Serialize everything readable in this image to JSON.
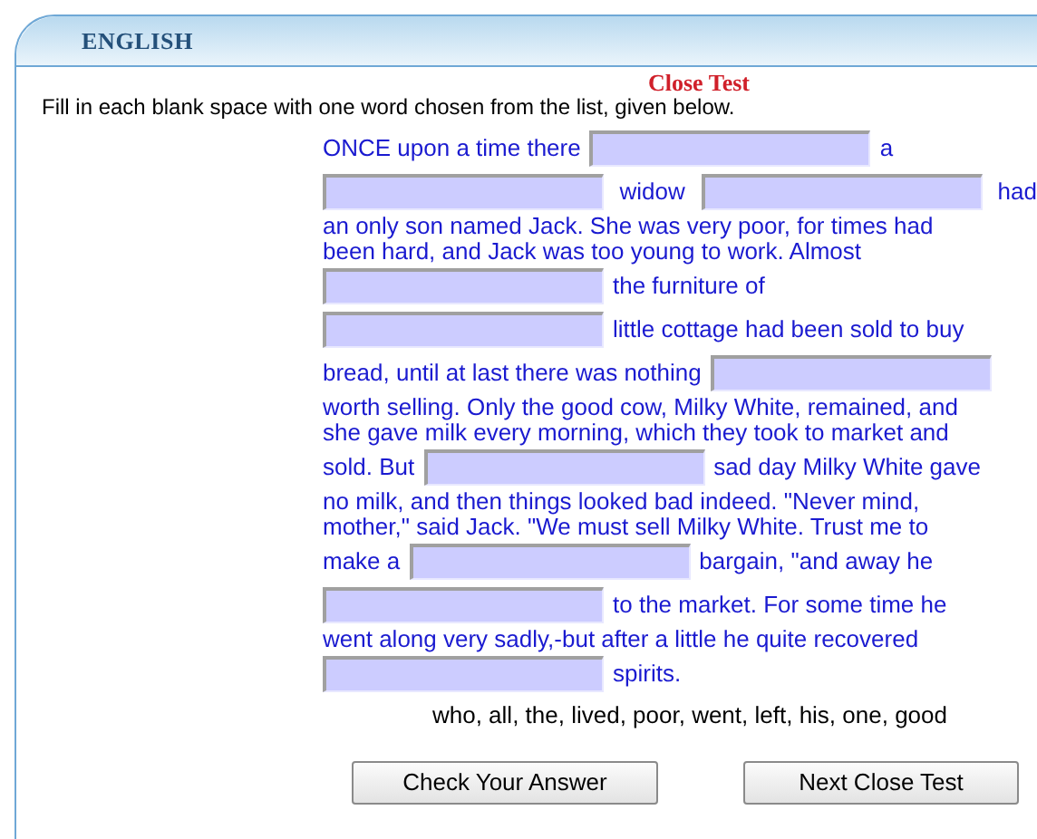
{
  "panel": {
    "title": "ENGLISH"
  },
  "test_title": "Close Test",
  "instruction": "Fill in each blank space with one word chosen from the list, given below.",
  "passage_lines": [
    [
      {
        "kind": "text",
        "text": "ONCE upon a time there"
      },
      {
        "kind": "blank"
      },
      {
        "kind": "text",
        "text": "a"
      }
    ],
    [
      {
        "kind": "blank"
      },
      {
        "kind": "text",
        "text": "widow"
      },
      {
        "kind": "blank"
      },
      {
        "kind": "text",
        "text": "had"
      }
    ],
    [
      {
        "kind": "text",
        "text": "an only son named Jack. She was very poor, for times had"
      }
    ],
    [
      {
        "kind": "text",
        "text": "been hard, and Jack was too young to work. Almost"
      }
    ],
    [
      {
        "kind": "blank"
      },
      {
        "kind": "text",
        "text": "the furniture of"
      }
    ],
    [
      {
        "kind": "blank"
      },
      {
        "kind": "text",
        "text": "little cottage had been sold to buy"
      }
    ],
    [
      {
        "kind": "text",
        "text": "bread, until at last there was nothing"
      },
      {
        "kind": "blank"
      }
    ],
    [
      {
        "kind": "text",
        "text": "worth selling. Only the good cow, Milky White, remained, and"
      }
    ],
    [
      {
        "kind": "text",
        "text": "she gave milk every morning, which they took to market and"
      }
    ],
    [
      {
        "kind": "text",
        "text": "sold. But"
      },
      {
        "kind": "blank"
      },
      {
        "kind": "text",
        "text": "sad day Milky White gave"
      }
    ],
    [
      {
        "kind": "text",
        "text": "no milk, and then things looked bad indeed. \"Never mind,"
      }
    ],
    [
      {
        "kind": "text",
        "text": "mother,\" said Jack. \"We must sell Milky White. Trust me to"
      }
    ],
    [
      {
        "kind": "text",
        "text": "make a"
      },
      {
        "kind": "blank"
      },
      {
        "kind": "text",
        "text": "bargain, \"and away he"
      }
    ],
    [
      {
        "kind": "blank"
      },
      {
        "kind": "text",
        "text": "to the market. For some time he"
      }
    ],
    [
      {
        "kind": "text",
        "text": "went along very sadly,-but after a little he quite recovered"
      }
    ],
    [
      {
        "kind": "blank"
      },
      {
        "kind": "text",
        "text": "spirits."
      }
    ]
  ],
  "word_list": "who, all, the, lived, poor, went, left, his, one, good",
  "buttons": [
    "Check Your Answer",
    "Next Close Test"
  ]
}
